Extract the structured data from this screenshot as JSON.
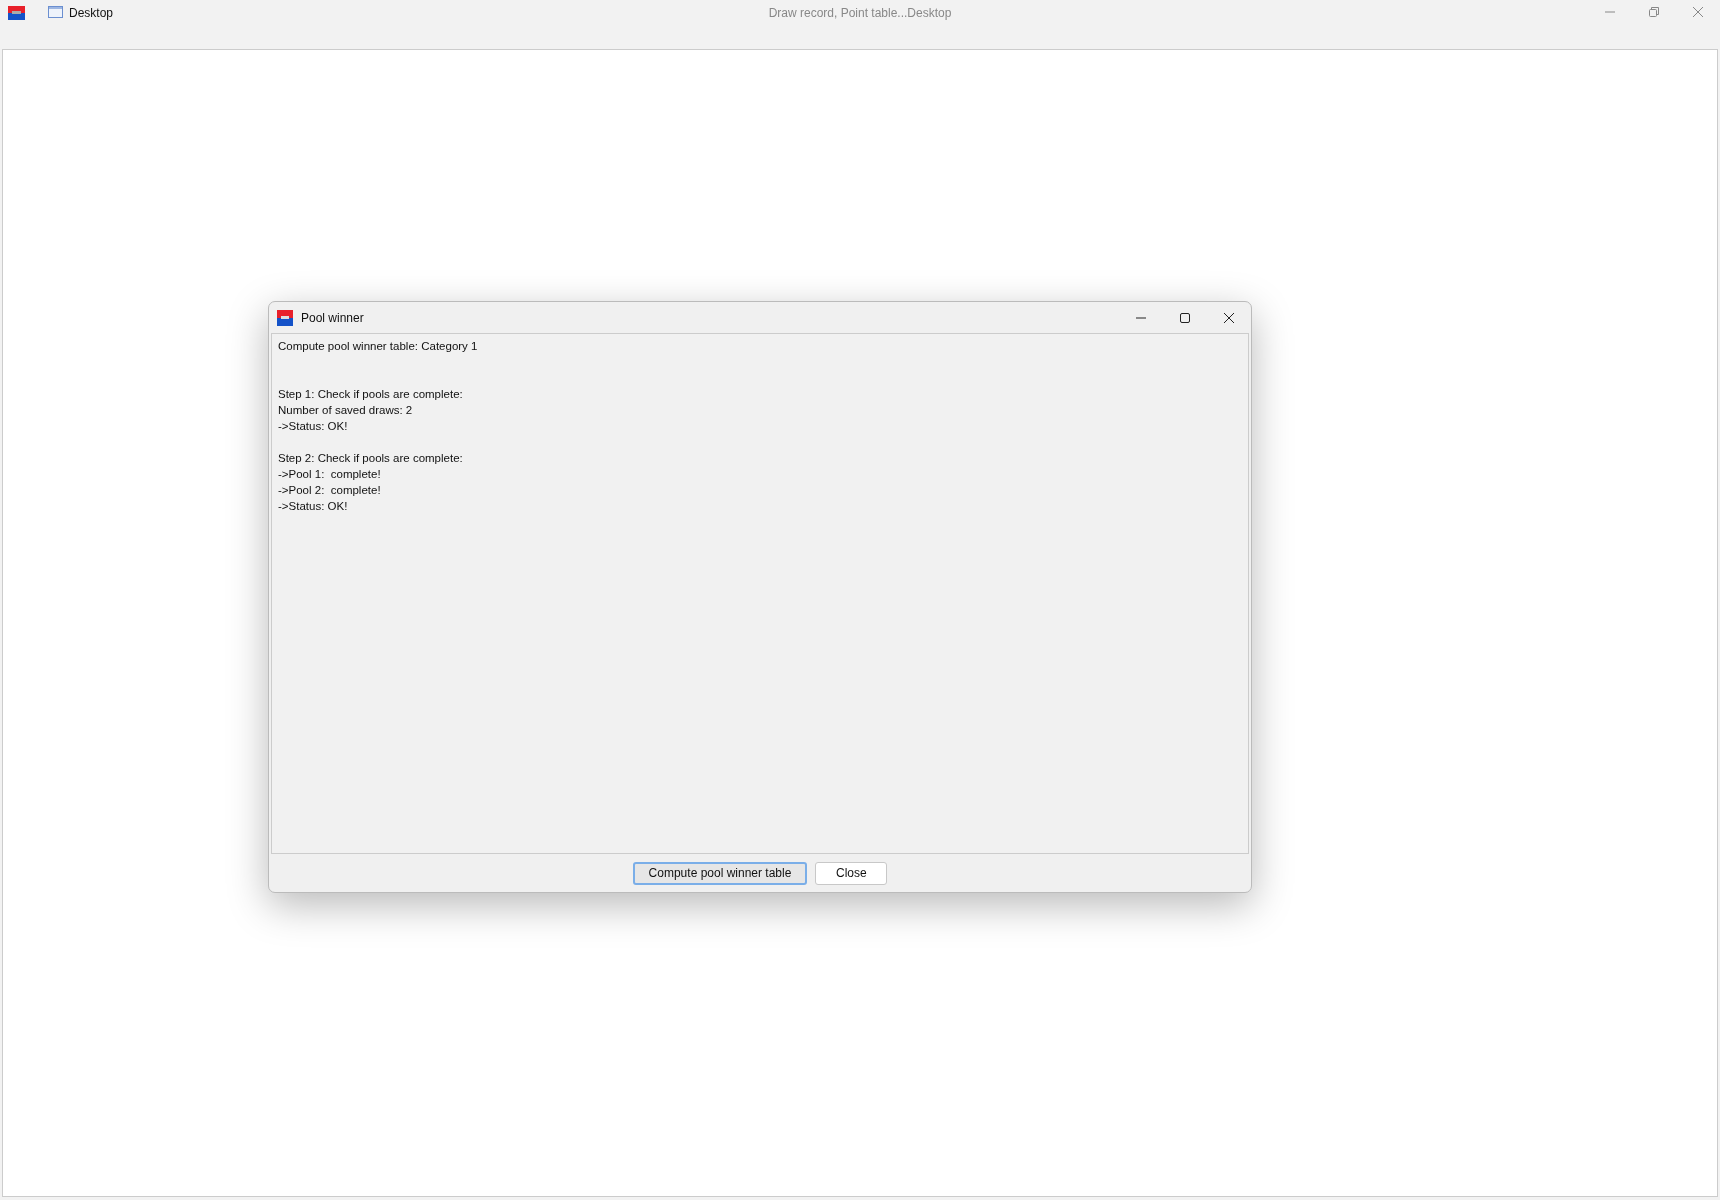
{
  "main_window": {
    "tab_label": "Desktop",
    "title": "Draw record, Point table...Desktop"
  },
  "dialog": {
    "title": "Pool winner",
    "log_blocks": [
      {
        "lines": [
          "Compute pool winner table: Category 1"
        ]
      },
      {
        "lines": [
          "Step 1: Check if pools are complete:",
          "Number of saved draws: 2",
          "->Status: OK!"
        ]
      },
      {
        "lines": [
          "Step 2: Check if pools are complete:",
          "->Pool 1:  complete!",
          "->Pool 2:  complete!",
          "->Status: OK!"
        ]
      }
    ],
    "buttons": [
      {
        "label": "Compute pool winner table",
        "selected": true
      },
      {
        "label": "Close",
        "selected": false
      }
    ]
  }
}
